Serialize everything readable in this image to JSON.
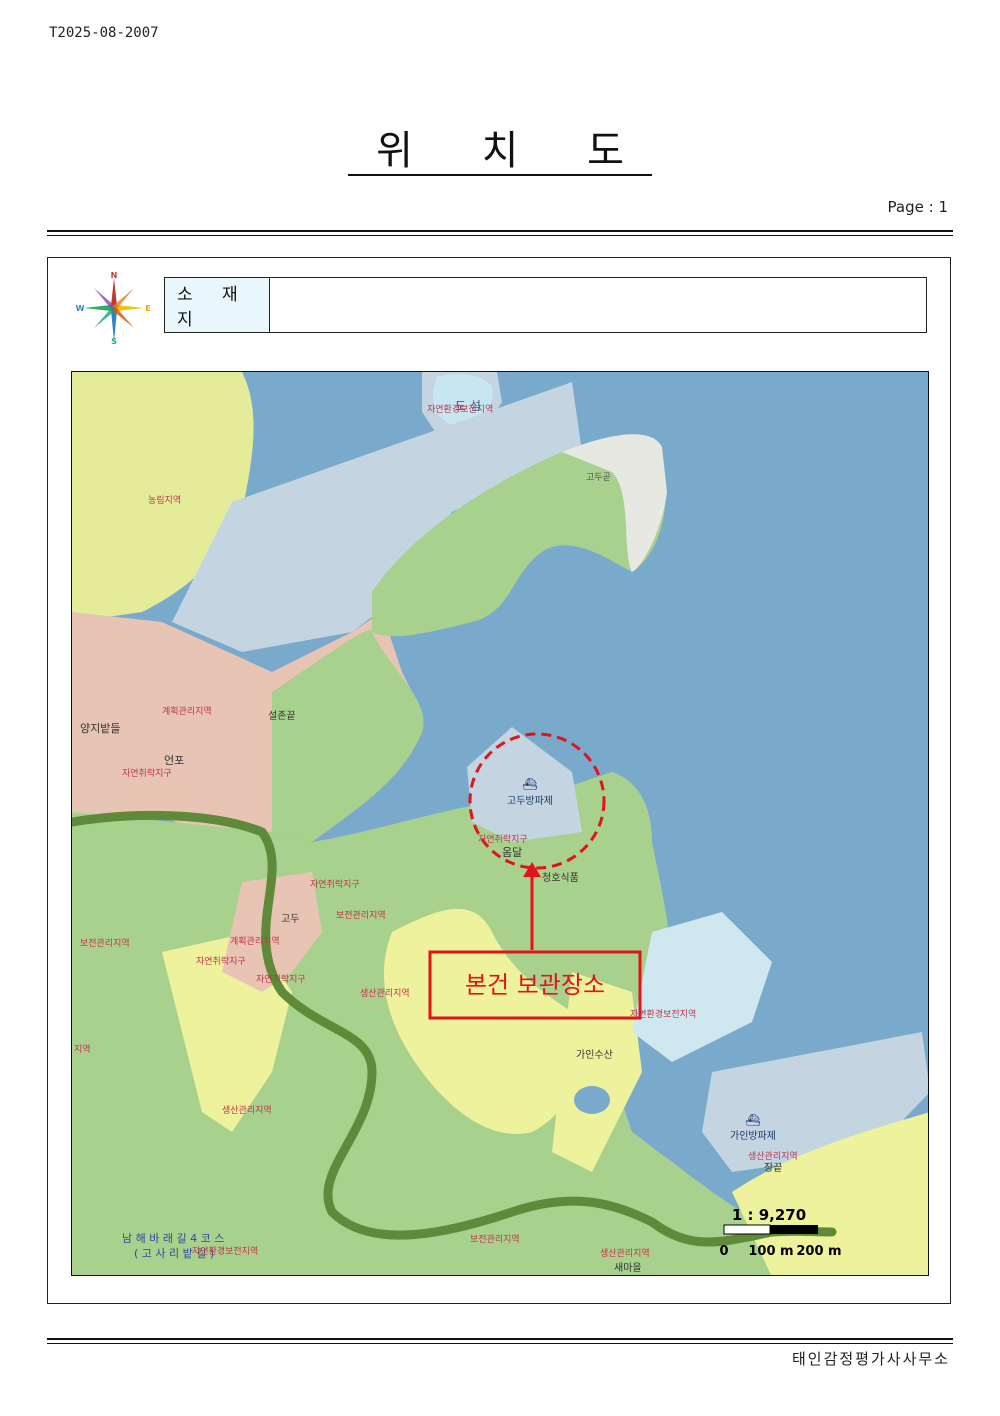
{
  "header": {
    "doc_id": "T2025-08-2007",
    "title": "위 치 도",
    "page": "Page : 1"
  },
  "compass": {
    "n": "N",
    "s": "S",
    "e": "E",
    "w": "W"
  },
  "address": {
    "label": "소 재 지",
    "value": ""
  },
  "map": {
    "callout": "본건 보관장소",
    "scale": {
      "ratio": "1 : 9,270",
      "t0": "0",
      "t1": "100 m",
      "t2": "200 m"
    },
    "labels": {
      "dongseom": "도 섬",
      "jayeonhwangyeong1": "자연환경보전지역",
      "godugot": "고두곧",
      "nongnim": "농림지역",
      "gyehoek1": "계획관리지역",
      "seoljongot": "설존끝",
      "yangjibat": "양지밭들",
      "eonpo": "언포",
      "chwirak1": "자연취락지구",
      "godubang": "고두방파제",
      "chwirak2": "자연취락지구",
      "omdal": "옴달",
      "chwirak3": "자연취락지구",
      "cheongho": "청호식품",
      "godu": "고두",
      "bojeon1": "보전관리지역",
      "bojeon2": "보전관리지역",
      "gyehoek2": "계획관리지역",
      "chwirak4": "자연취락지구",
      "chwirak5": "자연취락지구",
      "saengsan1": "생산관리지역",
      "jayeonhwangyeong2": "자연환경보전지역",
      "jiyeok": "지역",
      "gainsusan": "가인수산",
      "saengsan2": "생산관리지역",
      "gainbang": "가인방파제",
      "saengsan3": "생산관리지역",
      "janggot": "장끝",
      "trail1": "남 해 바 래 길 4 코 스",
      "trail2": "( 고 사 리 밭 길 )",
      "jayeonhwangyeong3": "자연환경보전지역",
      "bojeon3": "보전관리지역",
      "saengsan4": "생산관리지역",
      "saemaeul": "새마을"
    }
  },
  "footer": {
    "office": "태인감정평가사사무소"
  },
  "colors": {
    "sea": "#79aacb",
    "land_green": "#a9d18e",
    "land_yellow": "#eef29c",
    "land_pink": "#e8c4b4",
    "reclaim": "#c4d4e0",
    "callout_red": "#e0141a",
    "trail": "#5e8a3a"
  }
}
